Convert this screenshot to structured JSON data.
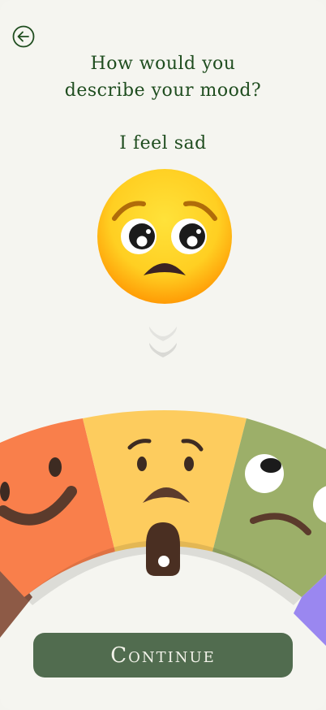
{
  "header": {
    "title_line1": "How would you",
    "title_line2": "describe your mood?"
  },
  "mood": {
    "label": "I feel sad",
    "emoji": "sad-face-emoji",
    "selected_segment": "sad"
  },
  "dial": {
    "segments": [
      {
        "name": "happy",
        "color": "#f97f4b"
      },
      {
        "name": "sad",
        "color": "#fdcc5e"
      },
      {
        "name": "confused",
        "color": "#9caf69"
      }
    ]
  },
  "actions": {
    "continue_label": "Continue"
  },
  "colors": {
    "accent": "#1f4d1f",
    "button": "#516c4f",
    "background": "#f5f5f0"
  }
}
